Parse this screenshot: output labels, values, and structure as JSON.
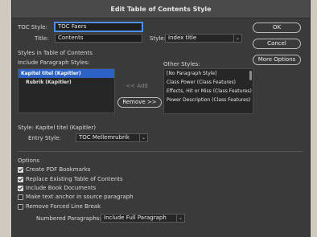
{
  "window": {
    "title": "Edit Table of Contents Style"
  },
  "toc_style": {
    "label": "TOC Style:",
    "value": "TOC Faers"
  },
  "title": {
    "label": "Title:",
    "value": "Contents"
  },
  "style": {
    "label": "Style:",
    "value": "Index title"
  },
  "buttons": {
    "ok": "OK",
    "cancel": "Cancel",
    "more_options": "More Options",
    "add": "<< Add",
    "remove": "Remove >>"
  },
  "styles_section": {
    "heading": "Styles in Table of Contents",
    "include_label": "Include Paragraph Styles:",
    "include_items": [
      "Kapitel titel (Kapitler)",
      "Rubrik (Kapitler)"
    ],
    "other_label": "Other Styles:",
    "other_items": [
      "[No Paragraph Style]",
      "Class Power (Class Features)",
      "Effects, Hit or Miss (Class Features)",
      "Power Description (Class Features)"
    ]
  },
  "style_detail": {
    "label": "Style: Kapitel titel (Kapitler)",
    "entry_label": "Entry Style:",
    "entry_value": "TOC Mellemrubrik"
  },
  "options": {
    "heading": "Options",
    "checkboxes": [
      {
        "label": "Create PDF Bookmarks",
        "checked": true
      },
      {
        "label": "Replace Existing Table of Contents",
        "checked": true
      },
      {
        "label": "Include Book Documents",
        "checked": true
      },
      {
        "label": "Make text anchor in source paragraph",
        "checked": false
      },
      {
        "label": "Remove Forced Line Break",
        "checked": false
      }
    ],
    "numbered_label": "Numbered Paragraphs:",
    "numbered_value": "Include Full Paragraph"
  }
}
